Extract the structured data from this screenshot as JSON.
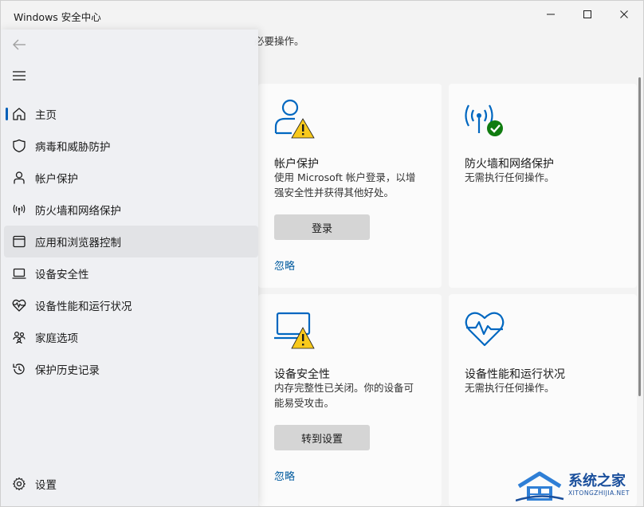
{
  "window": {
    "title": "Windows 安全中心"
  },
  "main": {
    "top_text": "必要操作。",
    "cards": [
      {
        "title": "帐户保护",
        "description_line1": "使用 Microsoft 帐户登录，以增",
        "description_line2": "强安全性并获得其他好处。",
        "button_label": "登录",
        "link_label": "忽略",
        "icon": "person-warning-icon"
      },
      {
        "title": "防火墙和网络保护",
        "description_line1": "无需执行任何操作。",
        "icon": "wireless-ok-icon"
      },
      {
        "title": "设备安全性",
        "description_line1": "内存完整性已关闭。你的设备可",
        "description_line2": "能易受攻击。",
        "button_label": "转到设置",
        "link_label": "忽略",
        "icon": "laptop-warning-icon"
      },
      {
        "title": "设备性能和运行状况",
        "description_line1": "无需执行任何操作。",
        "icon": "heart-pulse-icon"
      }
    ]
  },
  "nav": {
    "items": [
      {
        "label": "主页",
        "icon": "home-icon"
      },
      {
        "label": "病毒和威胁防护",
        "icon": "shield-icon"
      },
      {
        "label": "帐户保护",
        "icon": "person-icon"
      },
      {
        "label": "防火墙和网络保护",
        "icon": "wireless-icon"
      },
      {
        "label": "应用和浏览器控制",
        "icon": "app-window-icon"
      },
      {
        "label": "设备安全性",
        "icon": "laptop-icon"
      },
      {
        "label": "设备性能和运行状况",
        "icon": "heart-pulse-icon"
      },
      {
        "label": "家庭选项",
        "icon": "family-icon"
      },
      {
        "label": "保护历史记录",
        "icon": "history-icon"
      }
    ],
    "settings_label": "设置"
  },
  "watermark": {
    "name": "系统之家",
    "url": "XITONGZHIJIA.NET"
  },
  "colors": {
    "accent": "#005fb8",
    "link": "#005a9e",
    "warning": "#f8c91c",
    "ok": "#107c10",
    "icon_blue": "#0067c0"
  }
}
